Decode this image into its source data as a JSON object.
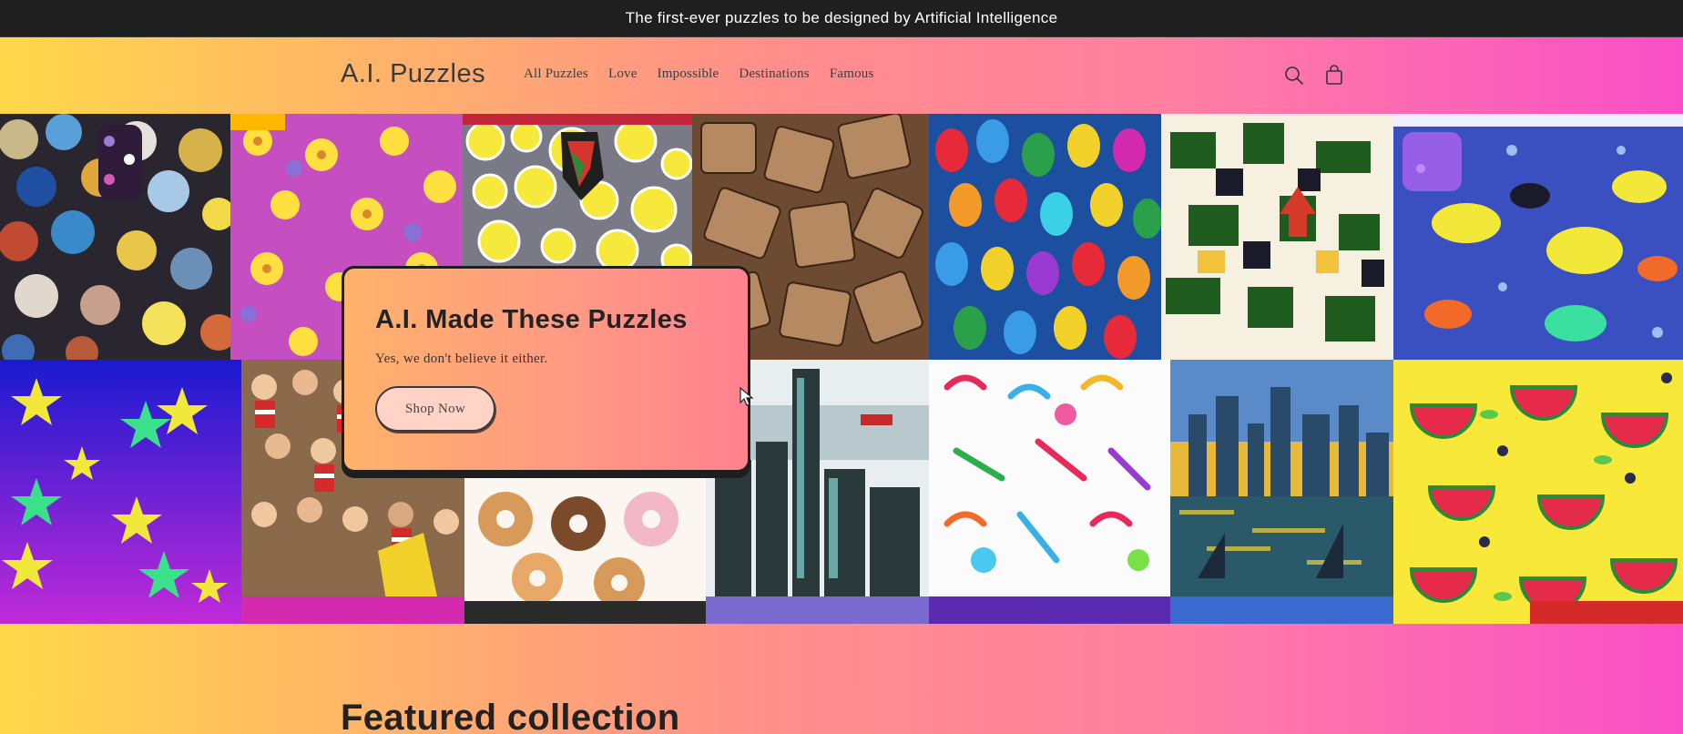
{
  "announcement": {
    "text": "The first-ever puzzles to be designed by Artificial Intelligence"
  },
  "header": {
    "logo": "A.I. Puzzles",
    "nav": [
      "All Puzzles",
      "Love",
      "Impossible",
      "Destinations",
      "Famous"
    ],
    "icons": [
      "search-icon",
      "cart-icon"
    ]
  },
  "hero": {
    "title": "A.I. Made These Puzzles",
    "subtitle": "Yes, we don't believe it either.",
    "button": "Shop Now",
    "tiles": [
      "marbles",
      "flowers",
      "bubbles",
      "puzzle-pieces",
      "balloons",
      "jigsaw-camo",
      "fish",
      "stars",
      "crowd",
      "donuts",
      "city-skyline",
      "candy",
      "harbor-painting",
      "watermelon"
    ]
  },
  "featured": {
    "title": "Featured collection"
  },
  "colors": {
    "announcement_bg": "#1f1f1f",
    "gradient_start": "#ffd84a",
    "gradient_end": "#f94fc6",
    "card_bg": "#ff9a84",
    "button_bg": "#ffd3c6"
  }
}
